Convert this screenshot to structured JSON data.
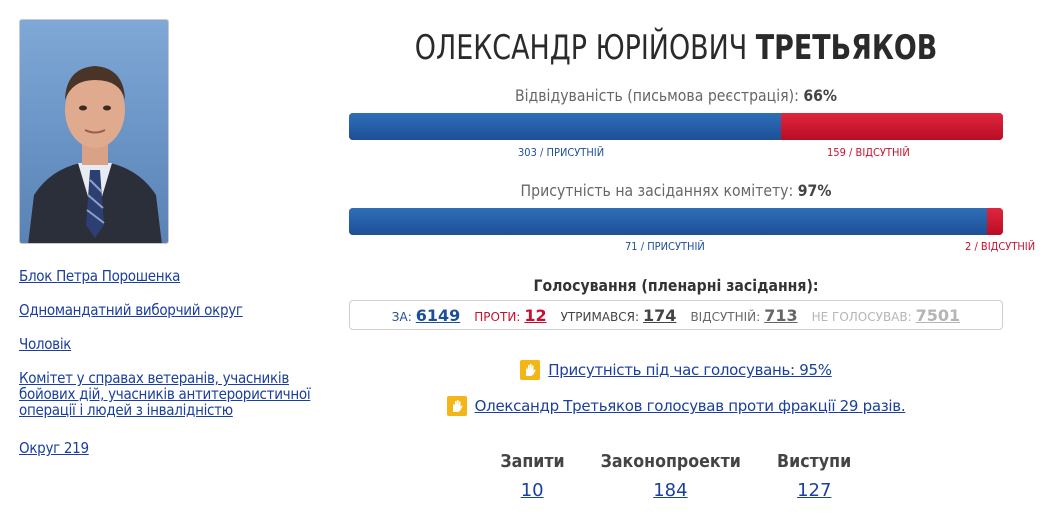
{
  "deputy": {
    "first_names": "ОЛЕКСАНДР ЮРІЙОВИЧ",
    "last_name": "ТРЕТЬЯКОВ"
  },
  "sidebar": {
    "links": [
      "Блок Петра Порошенка",
      "Одномандатний виборчий округ",
      "Чоловік",
      "Комітет у справах ветеранів, учасників бойових дій, учасників антитерористичної операції і людей з інвалідністю",
      "Округ 219"
    ]
  },
  "attendance": {
    "label": "Відвідуваність (письмова реєстрація):",
    "percent_text": "66%",
    "present_fraction": 0.66,
    "present_caption": "303 / ПРИСУТНІЙ",
    "absent_caption": "159 / ВІДСУТНІЙ"
  },
  "committee": {
    "label": "Присутність на засіданнях комітету:",
    "percent_text": "97%",
    "present_fraction": 0.975,
    "present_caption": "71 / ПРИСУТНІЙ",
    "absent_caption": "2 / ВІДСУТНІЙ"
  },
  "votes": {
    "title": "Голосування (пленарні засідання):",
    "for_label": "ЗА:",
    "for_value": "6149",
    "against_label": "ПРОТИ:",
    "against_value": "12",
    "abstain_label": "УТРИМАВСЯ:",
    "abstain_value": "174",
    "absent_label": "ВІДСУТНІЙ:",
    "absent_value": "713",
    "novote_label": "НЕ ГОЛОСУВАВ:",
    "novote_value": "7501"
  },
  "info": {
    "presence_link": "Присутність під час голосувань: 95%",
    "faction_link": "Олександр Третьяков голосував проти фракції 29 разів."
  },
  "counters": {
    "requests_label": "Запити",
    "requests_value": "10",
    "bills_label": "Законопроекти",
    "bills_value": "184",
    "speeches_label": "Виступи",
    "speeches_value": "127"
  },
  "colors": {
    "present": "#1d4f96",
    "absent": "#c8102e",
    "link": "#1a3f9e",
    "icon": "#f2b617"
  }
}
